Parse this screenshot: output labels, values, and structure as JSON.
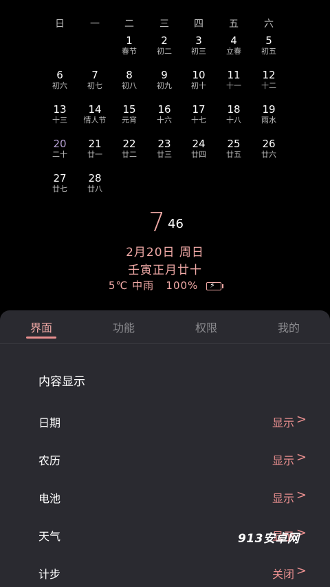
{
  "calendar": {
    "weekdays": [
      "日",
      "一",
      "二",
      "三",
      "四",
      "五",
      "六"
    ],
    "days": [
      {
        "d": "1",
        "l": "春节"
      },
      {
        "d": "2",
        "l": "初二"
      },
      {
        "d": "3",
        "l": "初三"
      },
      {
        "d": "4",
        "l": "立春"
      },
      {
        "d": "5",
        "l": "初五"
      },
      {
        "d": "6",
        "l": "初六"
      },
      {
        "d": "7",
        "l": "初七"
      },
      {
        "d": "8",
        "l": "初八"
      },
      {
        "d": "9",
        "l": "初九"
      },
      {
        "d": "10",
        "l": "初十"
      },
      {
        "d": "11",
        "l": "十一"
      },
      {
        "d": "12",
        "l": "十二"
      },
      {
        "d": "13",
        "l": "十三"
      },
      {
        "d": "14",
        "l": "情人节"
      },
      {
        "d": "15",
        "l": "元宵"
      },
      {
        "d": "16",
        "l": "十六"
      },
      {
        "d": "17",
        "l": "十七"
      },
      {
        "d": "18",
        "l": "十八"
      },
      {
        "d": "19",
        "l": "雨水"
      },
      {
        "d": "20",
        "l": "二十"
      },
      {
        "d": "21",
        "l": "廿一"
      },
      {
        "d": "22",
        "l": "廿二"
      },
      {
        "d": "23",
        "l": "廿三"
      },
      {
        "d": "24",
        "l": "廿四"
      },
      {
        "d": "25",
        "l": "廿五"
      },
      {
        "d": "26",
        "l": "廿六"
      },
      {
        "d": "27",
        "l": "廿七"
      },
      {
        "d": "28",
        "l": "廿八"
      }
    ],
    "today": "20"
  },
  "clock": {
    "hour": "7",
    "minute": "46"
  },
  "info": {
    "date": "2月20日 周日",
    "lunar": "壬寅正月廿十",
    "weather": "5℃ 中雨",
    "battery": "100%"
  },
  "tabs": [
    "界面",
    "功能",
    "权限",
    "我的"
  ],
  "section_title": "内容显示",
  "settings": [
    {
      "label": "日期",
      "value": "显示"
    },
    {
      "label": "农历",
      "value": "显示"
    },
    {
      "label": "电池",
      "value": "显示"
    },
    {
      "label": "天气",
      "value": "显示"
    },
    {
      "label": "计步",
      "value": "关闭"
    }
  ],
  "watermark": "913安卓网",
  "colors": {
    "accent": "#e98f8f",
    "panel": "#2a2a30",
    "background": "#000000",
    "today": "#b9a3d6"
  }
}
